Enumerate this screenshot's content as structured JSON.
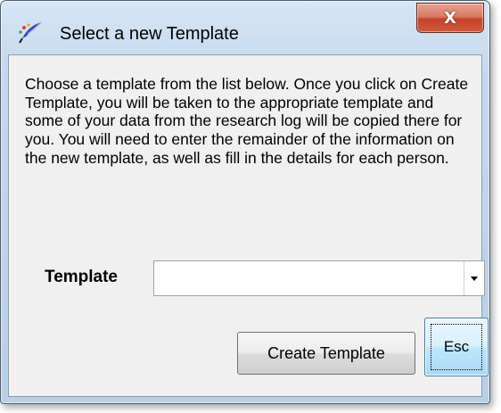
{
  "window": {
    "title": "Select a new Template",
    "close_label": "X",
    "app_icon": "quill-pen-icon",
    "close_icon": "close-icon"
  },
  "dialog": {
    "description": "Choose a template from the list below. Once you click on Create Template, you will be taken to the appropriate template and some of your data from the research log will be copied there for you. You will need to enter the remainder of the information on the new template, as well as fill in the details for each person.",
    "template_label": "Template",
    "template_value": "",
    "create_button_label": "Create Template",
    "esc_button_label": "Esc"
  },
  "colors": {
    "close_button": "#c4432a",
    "frame": "#b9cfe8",
    "client_background": "#f0f0f0",
    "focused_button_border": "#3c7fb1"
  }
}
